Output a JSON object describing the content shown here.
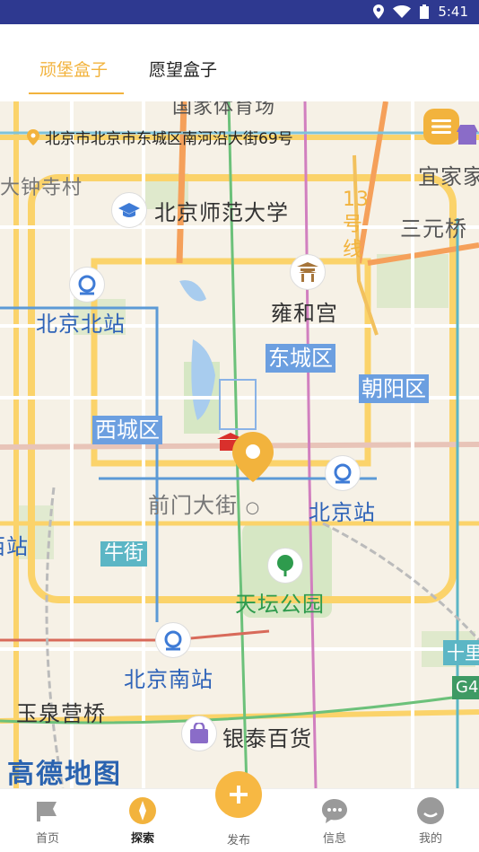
{
  "status_bar": {
    "time": "5:41"
  },
  "tabs": [
    {
      "label": "顽堡盒子",
      "active": true
    },
    {
      "label": "愿望盒子",
      "active": false
    }
  ],
  "map": {
    "address": "北京市北京市东城区南河沿大街69号",
    "labels": {
      "top_fragment": "国家体育场",
      "bell_temple": "大钟寺村",
      "bnu": "北京师范大学",
      "line13": "13号线",
      "yijia": "宜家家",
      "sanyuan": "三元桥",
      "bj_north": "北京北站",
      "yonghe": "雍和宫",
      "dongcheng": "东城区",
      "chaoyang": "朝阳区",
      "xicheng": "西城区",
      "qianmen": "前门大街",
      "bj_station": "北京站",
      "beijing_west_frag": "西站",
      "niujie": "牛街",
      "tiantan": "天坛公园",
      "bj_south": "北京南站",
      "shili": "十里",
      "yuquan": "玉泉营桥",
      "yintai": "银泰百货",
      "g4": "G4",
      "logo": "高德地图"
    }
  },
  "nav": [
    {
      "label": "首页"
    },
    {
      "label": "探索"
    },
    {
      "label": "发布"
    },
    {
      "label": "信息"
    },
    {
      "label": "我的"
    }
  ],
  "colors": {
    "accent": "#f2b33d",
    "status_bar": "#2e3990",
    "district": "#6c9fe0",
    "subway_label": "#2e63b8"
  }
}
